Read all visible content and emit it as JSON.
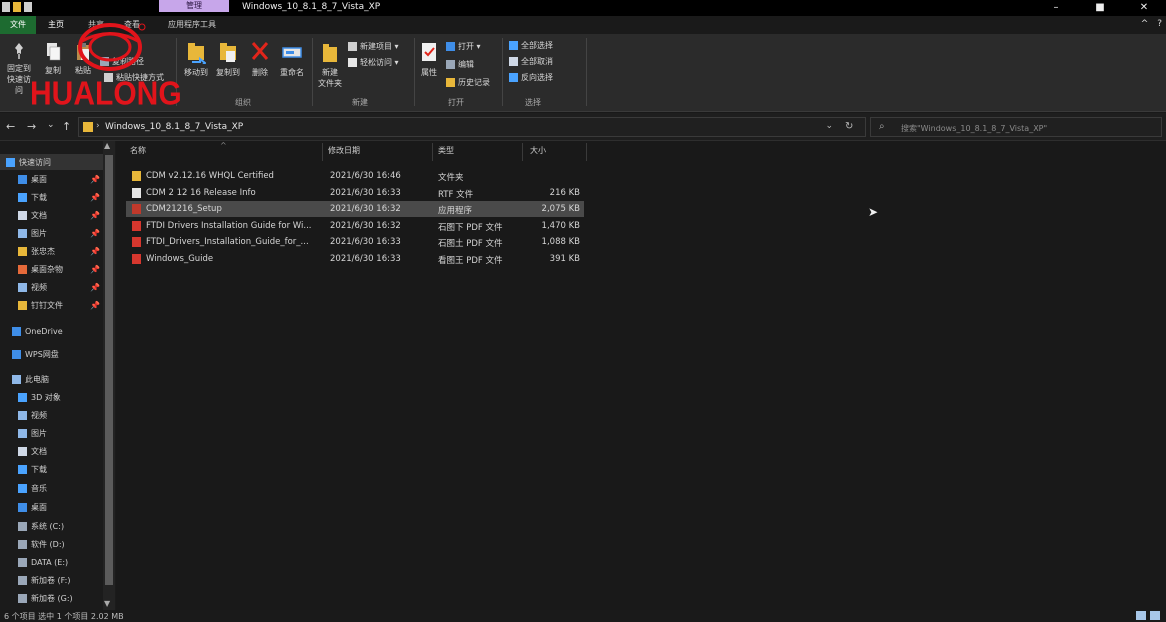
{
  "window": {
    "title": "Windows_10_8.1_8_7_Vista_XP",
    "context_tab_group": "管理",
    "controls": {
      "minimize": "–",
      "maximize": "■",
      "close": "✕"
    }
  },
  "ribbon_tabs": [
    {
      "label": "文件"
    },
    {
      "label": "主页"
    },
    {
      "label": "共享"
    },
    {
      "label": "查看"
    },
    {
      "label": "应用程序工具"
    }
  ],
  "ribbon_collapse": "^",
  "help": "?",
  "ribbon": {
    "pin_label_1": "固定到",
    "pin_label_2": "快速访问",
    "copy": "复制",
    "paste": "粘贴",
    "copy_path": "复制路径",
    "paste_shortcut": "粘贴快捷方式",
    "move_to": "移动到",
    "copy_to": "复制到",
    "delete": "删除",
    "rename": "重命名",
    "new_folder_1": "新建",
    "new_folder_2": "文件夹",
    "new_item": "新建项目 ▾",
    "easy_access": "轻松访问 ▾",
    "properties": "属性",
    "open": "打开 ▾",
    "edit": "编辑",
    "history": "历史记录",
    "select_all": "全部选择",
    "select_none": "全部取消",
    "invert": "反向选择",
    "groups": {
      "organize": "组织",
      "new": "新建",
      "open": "打开",
      "select": "选择"
    }
  },
  "logo": {
    "text": "HUALONG"
  },
  "address": {
    "back": "←",
    "forward": "→",
    "recent": "⌄",
    "up": "↑",
    "path": "Windows_10_8.1_8_7_Vista_XP",
    "chevron": "›",
    "dropdown": "⌄",
    "refresh": "↻",
    "search_placeholder": "搜索\"Windows_10_8.1_8_7_Vista_XP\""
  },
  "nav_items": [
    {
      "label": "快速访问",
      "color": "#4aa3ff",
      "pinned": false,
      "sel": true
    },
    {
      "label": "桌面",
      "color": "#3f8ee8",
      "pinned": true
    },
    {
      "label": "下载",
      "color": "#4aa3ff",
      "pinned": true
    },
    {
      "label": "文档",
      "color": "#cfd8e6",
      "pinned": true
    },
    {
      "label": "图片",
      "color": "#8fb8e8",
      "pinned": true
    },
    {
      "label": "张忠杰",
      "color": "#e8b73a",
      "pinned": true
    },
    {
      "label": "桌面杂物",
      "color": "#e66a3a",
      "pinned": true
    },
    {
      "label": "视频",
      "color": "#8fb8e8",
      "pinned": true
    },
    {
      "label": "钉钉文件",
      "color": "#e8b73a",
      "pinned": true
    },
    {
      "label": "OneDrive",
      "color": "#3f8ee8",
      "pinned": false
    },
    {
      "label": "WPS网盘",
      "color": "#3f8ee8",
      "pinned": false
    },
    {
      "label": "此电脑",
      "color": "#8fb8e8",
      "pinned": false
    },
    {
      "label": "3D 对象",
      "color": "#4aa3ff",
      "pinned": false
    },
    {
      "label": "视频",
      "color": "#8fb8e8",
      "pinned": false
    },
    {
      "label": "图片",
      "color": "#8fb8e8",
      "pinned": false
    },
    {
      "label": "文档",
      "color": "#cfd8e6",
      "pinned": false
    },
    {
      "label": "下载",
      "color": "#4aa3ff",
      "pinned": false
    },
    {
      "label": "音乐",
      "color": "#4aa3ff",
      "pinned": false
    },
    {
      "label": "桌面",
      "color": "#3f8ee8",
      "pinned": false
    },
    {
      "label": "系统 (C:)",
      "color": "#9aa7b8",
      "pinned": false
    },
    {
      "label": "软件 (D:)",
      "color": "#9aa7b8",
      "pinned": false
    },
    {
      "label": "DATA (E:)",
      "color": "#9aa7b8",
      "pinned": false
    },
    {
      "label": "新加卷 (F:)",
      "color": "#9aa7b8",
      "pinned": false
    },
    {
      "label": "新加卷 (G:)",
      "color": "#9aa7b8",
      "pinned": false
    }
  ],
  "pin_glyph": "📌",
  "columns": {
    "name": "名称",
    "date": "修改日期",
    "type": "类型",
    "size": "大小"
  },
  "files": [
    {
      "name": "CDM v2.12.16 WHQL Certified",
      "date": "2021/6/30 16:46",
      "type": "文件夹",
      "size": "",
      "icon": "folder"
    },
    {
      "name": "CDM 2 12 16 Release Info",
      "date": "2021/6/30 16:33",
      "type": "RTF 文件",
      "size": "216 KB",
      "icon": "doc"
    },
    {
      "name": "CDM21216_Setup",
      "date": "2021/6/30 16:32",
      "type": "应用程序",
      "size": "2,075 KB",
      "icon": "exe",
      "selected": true
    },
    {
      "name": "FTDI Drivers Installation Guide for Wi...",
      "date": "2021/6/30 16:32",
      "type": "石图下 PDF 文件",
      "size": "1,470 KB",
      "icon": "pdf"
    },
    {
      "name": "FTDI_Drivers_Installation_Guide_for_...",
      "date": "2021/6/30 16:33",
      "type": "石图土 PDF 文件",
      "size": "1,088 KB",
      "icon": "pdf"
    },
    {
      "name": "Windows_Guide",
      "date": "2021/6/30 16:33",
      "type": "看图王 PDF 文件",
      "size": "391 KB",
      "icon": "pdf"
    }
  ],
  "status": {
    "text": "6 个项目   选中 1 个项目  2.02 MB"
  },
  "colors": {
    "file_tab": "#1d6b30",
    "context_tab": "#c7a6ea",
    "logo_red": "#e1141b",
    "folder": "#e8b73a",
    "pdf_red": "#d6372e"
  }
}
